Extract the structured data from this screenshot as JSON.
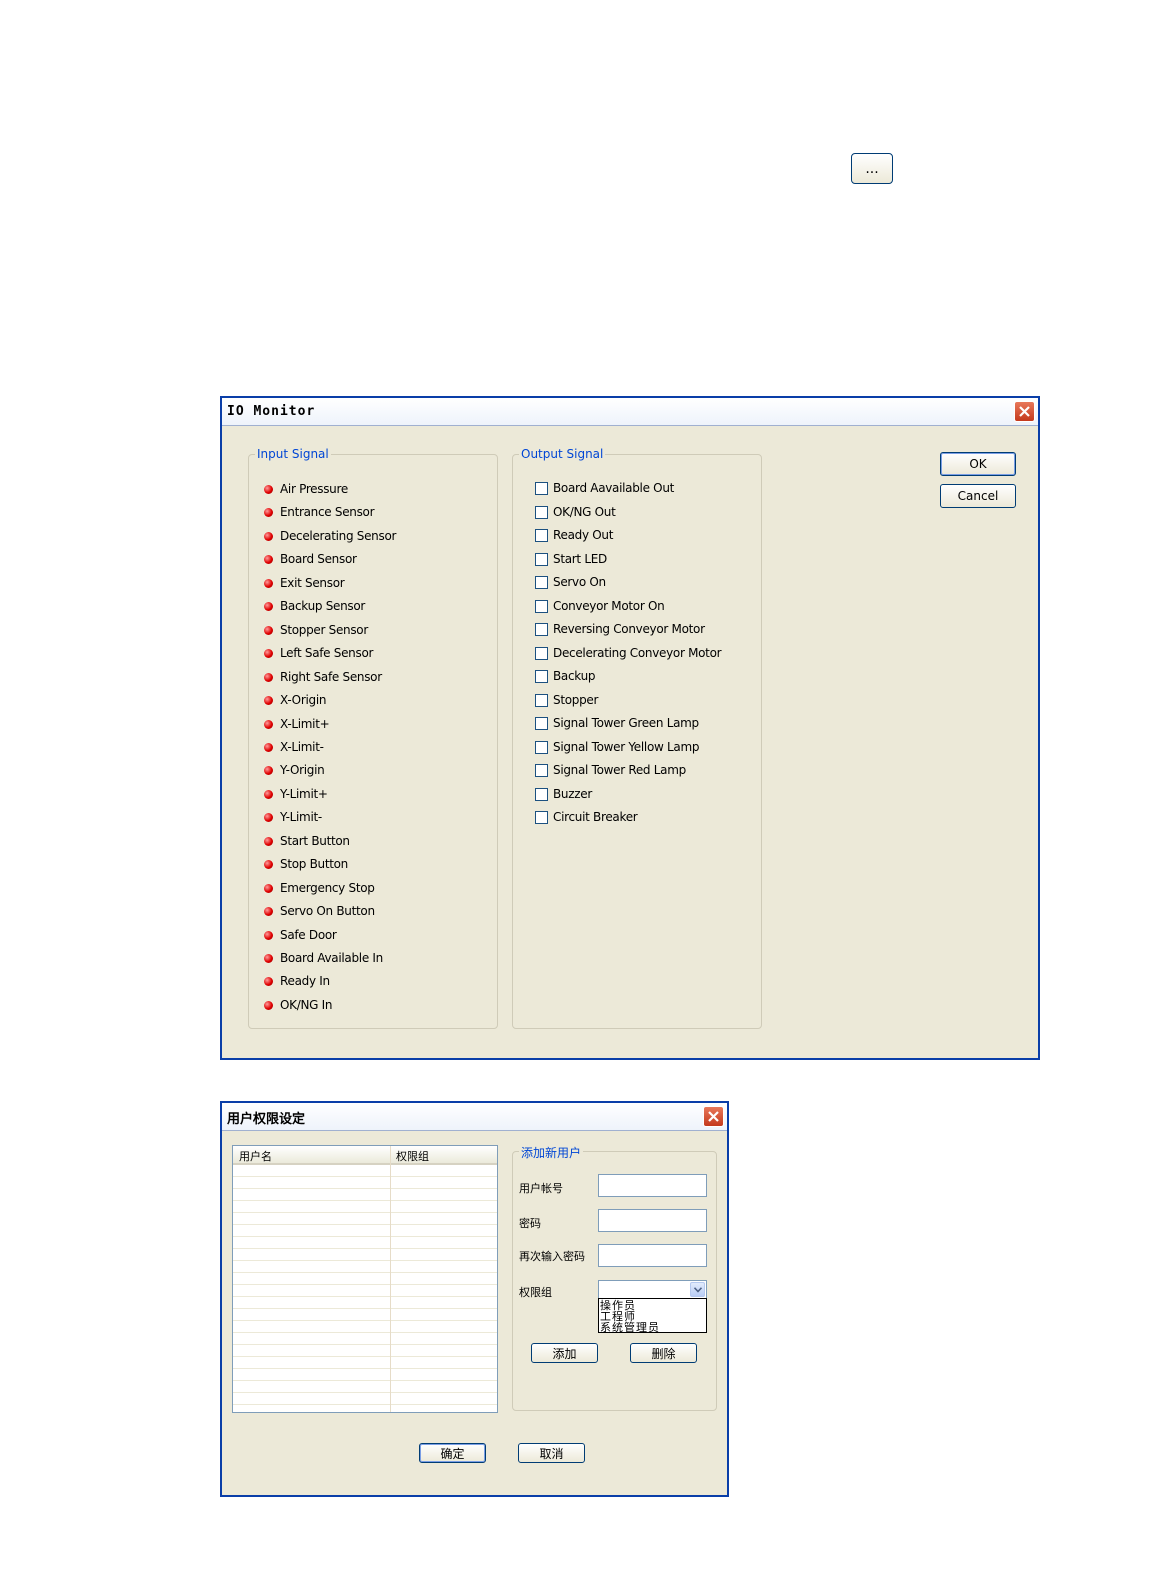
{
  "top_button": {
    "label": "..."
  },
  "io_monitor": {
    "title": "IO Monitor",
    "input_group": {
      "legend": "Input Signal",
      "items": [
        "Air Pressure",
        "Entrance Sensor",
        "Decelerating Sensor",
        "Board Sensor",
        "Exit Sensor",
        "Backup Sensor",
        "Stopper Sensor",
        "Left Safe Sensor",
        "Right Safe Sensor",
        "X-Origin",
        "X-Limit+",
        "X-Limit-",
        "Y-Origin",
        "Y-Limit+",
        "Y-Limit-",
        "Start Button",
        "Stop Button",
        "Emergency Stop",
        "Servo On Button",
        "Safe Door",
        "Board Available In",
        "Ready In",
        "OK/NG In"
      ]
    },
    "output_group": {
      "legend": "Output Signal",
      "items": [
        "Board Aavailable Out",
        "OK/NG Out",
        "Ready Out",
        "Start LED",
        "Servo On",
        "Conveyor Motor On",
        "Reversing Conveyor Motor",
        "Decelerating Conveyor Motor",
        "Backup",
        "Stopper",
        "Signal Tower Green Lamp",
        "Signal Tower Yellow Lamp",
        "Signal Tower Red Lamp",
        "Buzzer",
        "Circuit Breaker"
      ]
    },
    "ok_label": "OK",
    "cancel_label": "Cancel"
  },
  "user_dialog": {
    "title": "用户权限设定",
    "list_headers": [
      "用户名",
      "权限组"
    ],
    "group_legend": "添加新用户",
    "account_label": "用户帐号",
    "password_label": "密码",
    "confirm_password_label": "再次输入密码",
    "role_label": "权限组",
    "role_options": [
      "操作员",
      "工程师",
      "系统管理员"
    ],
    "add_label": "添加",
    "delete_label": "删除",
    "ok_label": "确定",
    "cancel_label": "取消"
  }
}
